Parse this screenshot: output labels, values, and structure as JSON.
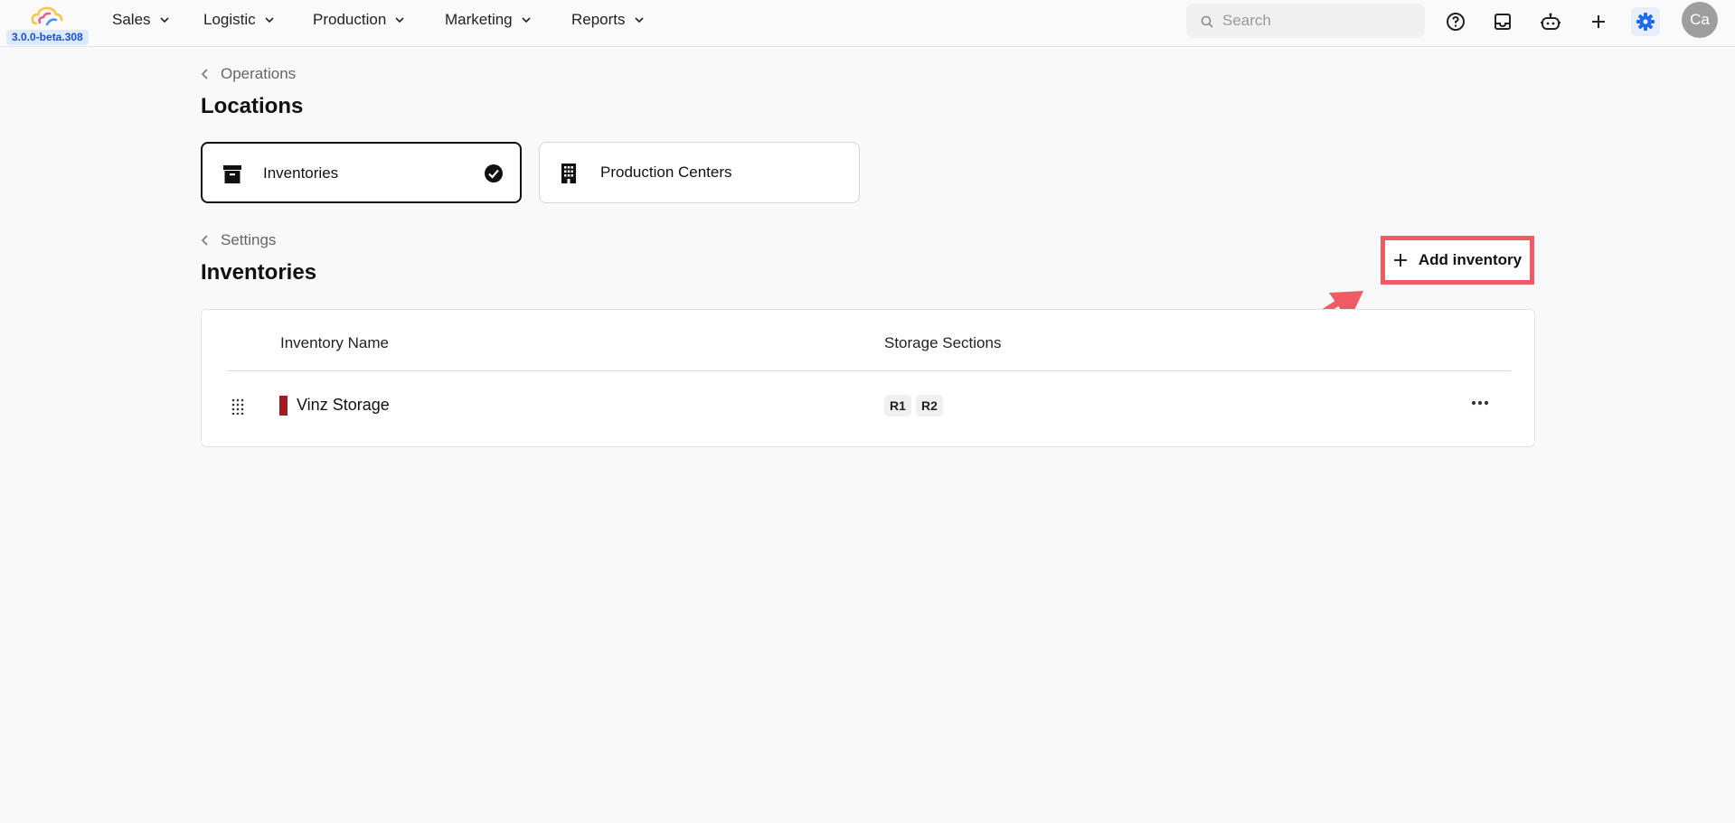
{
  "app": {
    "version": "3.0.0-beta.308"
  },
  "nav": {
    "items": [
      {
        "label": "Sales"
      },
      {
        "label": "Logistic"
      },
      {
        "label": "Production"
      },
      {
        "label": "Marketing"
      },
      {
        "label": "Reports"
      }
    ]
  },
  "search": {
    "placeholder": "Search"
  },
  "user": {
    "initials": "Ca"
  },
  "locations": {
    "breadcrumb": "Operations",
    "title": "Locations",
    "cards": [
      {
        "label": "Inventories",
        "icon": "archive-icon",
        "selected": true
      },
      {
        "label": "Production Centers",
        "icon": "building-icon",
        "selected": false
      }
    ]
  },
  "inventories": {
    "breadcrumb": "Settings",
    "title": "Inventories",
    "add_label": "Add inventory",
    "columns": [
      "Inventory Name",
      "Storage Sections"
    ],
    "rows": [
      {
        "name": "Vinz Storage",
        "color": "#a11a24",
        "sections": [
          "R1",
          "R2"
        ]
      }
    ]
  },
  "colors": {
    "highlight": "#ef5a64",
    "accent": "#1d6bf3"
  }
}
